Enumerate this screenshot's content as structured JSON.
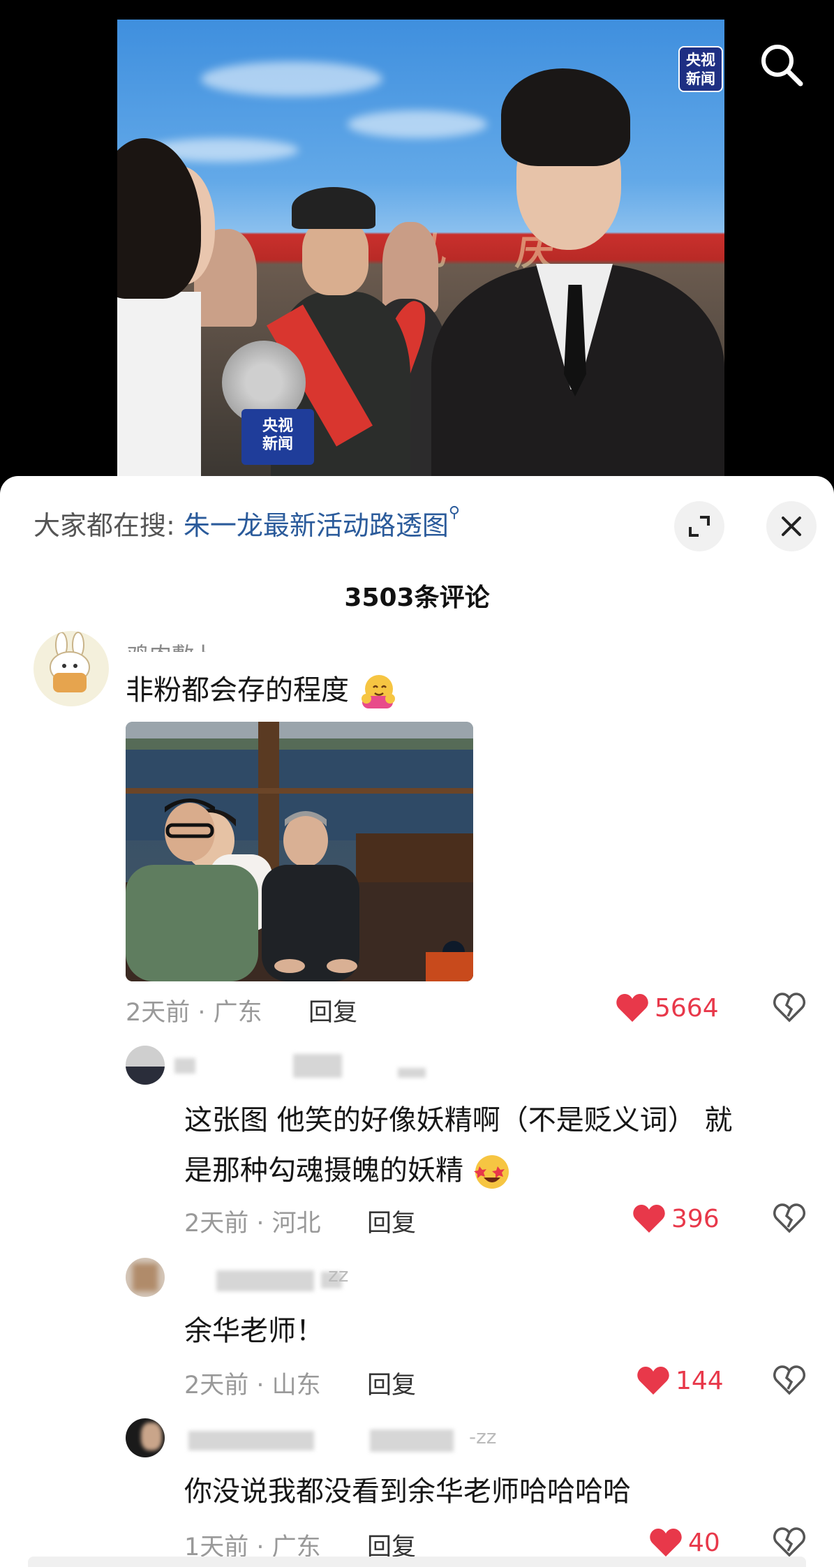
{
  "video": {
    "badge": "央视\n新闻",
    "mic_flag": "央视\n新闻",
    "banner": "礼 庆"
  },
  "sheet": {
    "hot_search_prefix": "大家都在搜: ",
    "hot_search_query": "朱一龙最新活动路透图",
    "comment_count_title": "3503条评论"
  },
  "comments": [
    {
      "username_partial": "鸡肉敷卜",
      "text": "非粉都会存的程度",
      "emoji": "hugging-face",
      "meta": "2天前 · 广东",
      "reply_label": "回复",
      "likes": "5664",
      "has_photo": true
    },
    {
      "text_line1": "这张图 他笑的好像妖精啊（不是贬义词） 就",
      "text_line2": "是那种勾魂摄魄的妖精",
      "emoji": "star-struck-face",
      "meta": "2天前 · 河北",
      "reply_label": "回复",
      "likes": "396"
    },
    {
      "username_partial": "zz",
      "text": "余华老师！",
      "meta": "2天前 · 山东",
      "reply_label": "回复",
      "likes": "144"
    },
    {
      "username_partial": "-zz",
      "text": "你没说我都没看到余华老师哈哈哈哈",
      "meta": "1天前 · 广东",
      "reply_label": "回复",
      "likes": "40"
    }
  ],
  "colors": {
    "like_red": "#e8384a",
    "link_blue": "#2b5b9b",
    "meta_gray": "#999999"
  }
}
